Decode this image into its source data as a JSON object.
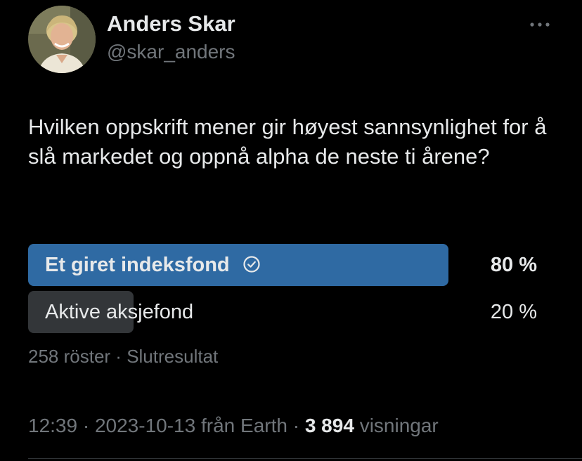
{
  "author": {
    "display_name": "Anders Skar",
    "handle": "@skar_anders",
    "avatar_icon": "profile-photo"
  },
  "more_icon": "ellipsis-icon",
  "tweet": {
    "text": "Hvilken oppskrift mener gir høyest sannsynlighet for å slå markedet og oppnå alpha de neste ti årene?"
  },
  "poll": {
    "options": [
      {
        "label": "Et giret indeksfond",
        "percent_label": "80 %",
        "share": 0.8,
        "winner": true,
        "bar_color": "#1d9bf0",
        "bar_fill": "#2f6aa3"
      },
      {
        "label": "Aktive aksjefond",
        "percent_label": "20 %",
        "share": 0.2,
        "winner": false,
        "bar_fill": "#333639"
      }
    ],
    "votes": "258 röster",
    "separator": " · ",
    "status": "Slutresultat"
  },
  "meta": {
    "time": "12:39",
    "date": "2023-10-13",
    "source": "från Earth",
    "views_count": "3 894",
    "views_label": "visningar",
    "separator": " · "
  },
  "colors": {
    "background": "#000000",
    "primary_text": "#e7e9ea",
    "secondary_text": "#71767b",
    "winner_bar": "#2f6aa3",
    "other_bar": "#333639"
  }
}
